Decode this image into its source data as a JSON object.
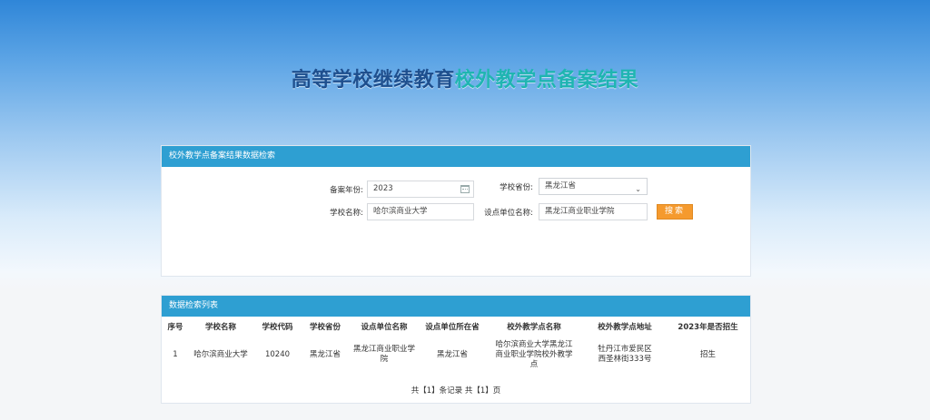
{
  "hero": {
    "title_part1": "高等学校继续教育",
    "title_part2": "校外教学点备案结果"
  },
  "search_panel": {
    "title": "校外教学点备案结果数据检索",
    "year_label": "备案年份:",
    "year_value": "2023",
    "province_label": "学校省份:",
    "province_value": "黑龙江省",
    "school_label": "学校名称:",
    "school_value": "哈尔滨商业大学",
    "unit_label": "设点单位名称:",
    "unit_value": "黑龙江商业职业学院",
    "search_button": "搜索"
  },
  "result_panel": {
    "title": "数据检索列表",
    "columns": [
      "序号",
      "学校名称",
      "学校代码",
      "学校省份",
      "设点单位名称",
      "设点单位所在省",
      "校外教学点名称",
      "校外教学点地址",
      "2023年是否招生"
    ],
    "rows": [
      [
        "1",
        "哈尔滨商业大学",
        "10240",
        "黑龙江省",
        "黑龙江商业职业学院",
        "黑龙江省",
        "哈尔滨商业大学黑龙江商业职业学院校外教学点",
        "牡丹江市爱民区西圣林街333号",
        "招生"
      ]
    ],
    "pager_text": "共【1】条记录 共【1】页"
  }
}
